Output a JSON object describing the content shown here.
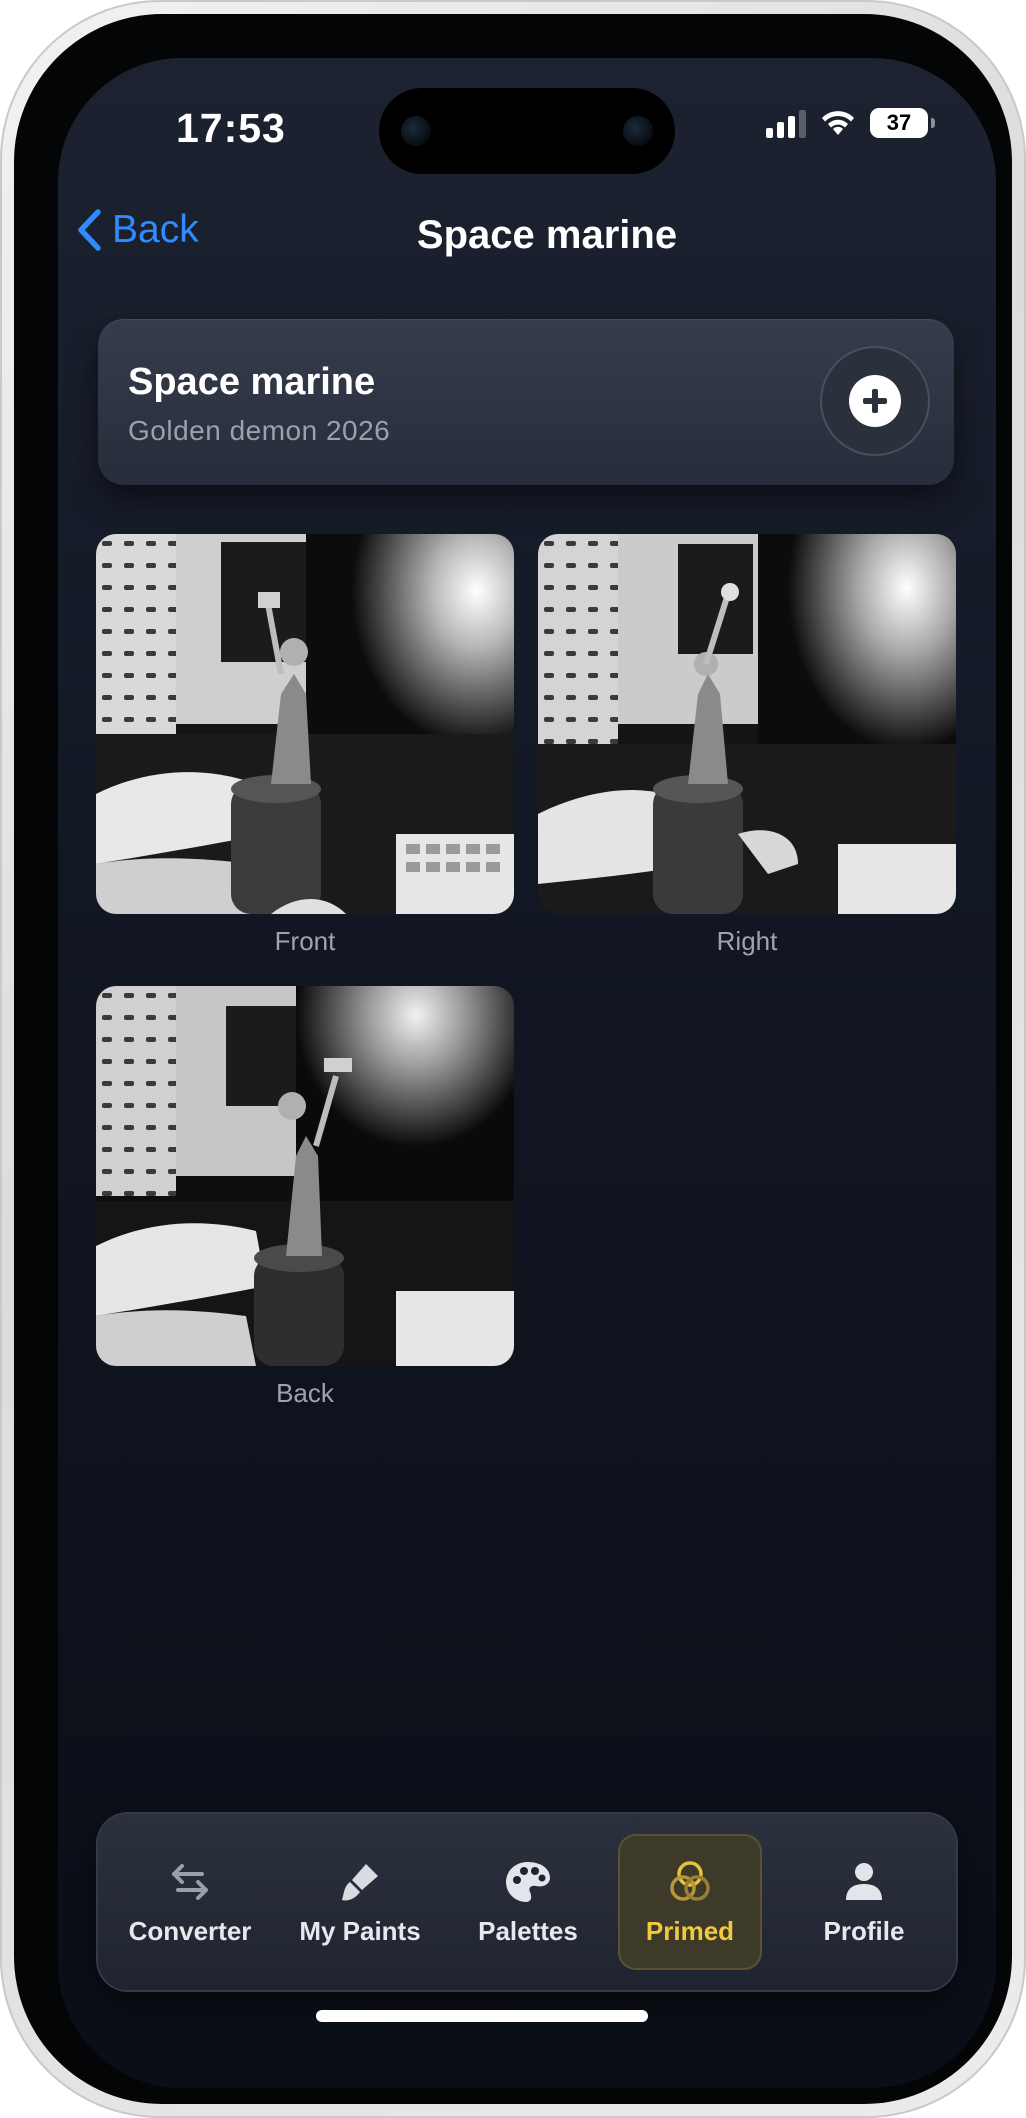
{
  "status_bar": {
    "time": "17:53",
    "battery": "37",
    "icons": [
      "cellular-signal-icon",
      "wifi-icon",
      "battery-icon"
    ]
  },
  "nav": {
    "back_label": "Back",
    "title": "Space marine"
  },
  "project": {
    "title": "Space marine",
    "subtitle": "Golden demon 2026",
    "add_icon": "plus-circle-icon"
  },
  "photos": [
    {
      "caption": "Front"
    },
    {
      "caption": "Right"
    },
    {
      "caption": "Back"
    }
  ],
  "tabs": [
    {
      "label": "Converter",
      "icon": "swap-arrows-icon"
    },
    {
      "label": "My Paints",
      "icon": "paint-brush-icon"
    },
    {
      "label": "Palettes",
      "icon": "palette-icon"
    },
    {
      "label": "Primed",
      "icon": "primed-rings-icon",
      "active": true
    },
    {
      "label": "Profile",
      "icon": "person-icon"
    }
  ],
  "colors": {
    "accent_blue": "#2f8cff",
    "active_tab_text": "#f0c93c",
    "background": "#121724"
  }
}
